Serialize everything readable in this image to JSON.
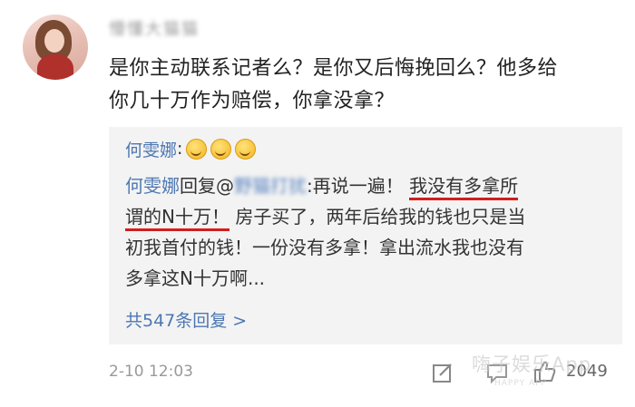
{
  "post": {
    "username": "懵懂大猫猫",
    "text_line1": "是你主动联系记者么？是你又后悔挽回么？他多给",
    "text_line2": "你几十万作为赔偿，你拿没拿？"
  },
  "reply": {
    "author": "何雯娜",
    "colon": ":",
    "reply_word": "回复@",
    "mention": "野猫打扰",
    "segment1": ":再说一遍！",
    "highlight1": "我没有多拿所",
    "highlight2": "谓的N十万！",
    "segment2": "房子买了，两年后给我的钱也只是当",
    "line3": "初我首付的钱！一份没有多拿！拿出流水我也没有",
    "line4": "多拿这N十万啊..."
  },
  "more_replies": "共547条回复 >",
  "footer": {
    "timestamp": "2-10 12:03",
    "like_count": "2049",
    "watermark_text": "嗨子娱乐App",
    "watermark_sub": "HAPPY APP"
  },
  "icons": {
    "edit": "edit-icon",
    "comment": "comment-icon",
    "like": "thumbs-up-icon",
    "emoji": "grin-emoji-icon"
  },
  "colors": {
    "link": "#4d77b2",
    "highlight_underline": "#d21d1d",
    "reply_bg": "#f3f3f3"
  }
}
